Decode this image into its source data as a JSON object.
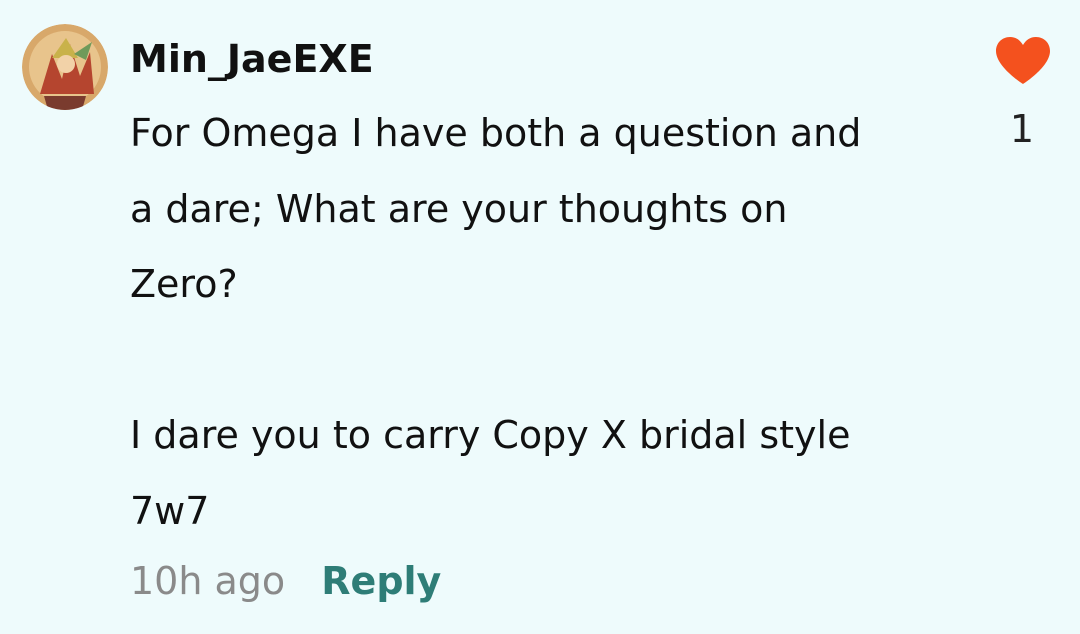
{
  "comment": {
    "username": "Min_JaeEXE",
    "avatar_icon": "avatar-icon",
    "body_lines": [
      "For Omega I have both a question and",
      "a dare; What are your thoughts on",
      "Zero?",
      "",
      "I dare you to carry Copy X bridal style",
      "7w7"
    ],
    "timestamp": "10h ago",
    "reply_label": "Reply",
    "like": {
      "icon": "heart-icon",
      "count": "1",
      "color": "#f4511e"
    }
  },
  "colors": {
    "background": "#eefbfc",
    "reply": "#2e7d77",
    "timestamp": "#8a8a8a"
  }
}
